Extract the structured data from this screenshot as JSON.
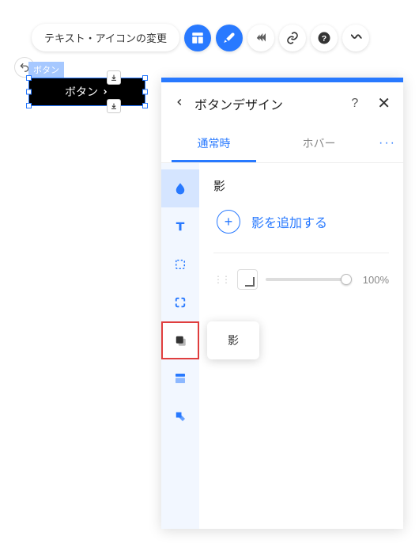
{
  "toolbar": {
    "label": "テキスト・アイコンの変更"
  },
  "canvas": {
    "selection_label": "ボタン",
    "button_text": "ボタン"
  },
  "panel": {
    "title": "ボタンデザイン",
    "tabs": {
      "normal": "通常時",
      "hover": "ホバー"
    },
    "tooltip": "影",
    "shadow": {
      "title": "影",
      "add_label": "影を追加する",
      "opacity": "100%"
    }
  }
}
